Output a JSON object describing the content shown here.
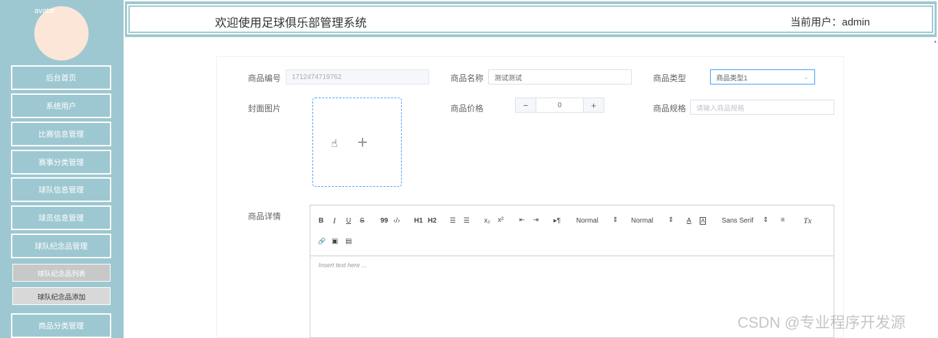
{
  "sidebar": {
    "avatar_alt": "avatar",
    "items": [
      {
        "label": "后台首页"
      },
      {
        "label": "系统用户"
      },
      {
        "label": "比赛信息管理"
      },
      {
        "label": "赛事分类管理"
      },
      {
        "label": "球队信息管理"
      },
      {
        "label": "球员信息管理"
      },
      {
        "label": "球队纪念品管理"
      },
      {
        "label": "商品分类管理"
      }
    ],
    "subitems": [
      {
        "label": "球队纪念品列表"
      },
      {
        "label": "球队纪念品添加"
      }
    ]
  },
  "header": {
    "title": "欢迎使用足球俱乐部管理系统",
    "user": "当前用户：admin"
  },
  "form": {
    "product_no_label": "商品编号",
    "product_no_value": "1712474719762",
    "product_name_label": "商品名称",
    "product_name_value": "测试测试",
    "product_type_label": "商品类型",
    "product_type_value": "商品类型1",
    "cover_label": "封面图片",
    "price_label": "商品价格",
    "price_value": "0",
    "price_minus": "−",
    "price_plus": "+",
    "spec_label": "商品规格",
    "spec_placeholder": "请输入商品规格",
    "detail_label": "商品详情"
  },
  "editor": {
    "toolbar": {
      "bold": "B",
      "italic": "I",
      "underline": "U",
      "strike": "S",
      "blockquote": "99",
      "code": "‹/›",
      "h1": "H1",
      "h2": "H2",
      "ordered_list": "☰",
      "bullet_list": "☰",
      "subscript": "x₂",
      "superscript": "x²",
      "outdent": "⇤",
      "indent": "⇥",
      "direction": "▸¶",
      "size_select": "Normal",
      "header_select": "Normal",
      "color": "A",
      "background": "A",
      "font_select": "Sans Serif",
      "align": "≡",
      "clean": "Tx",
      "link": "🔗",
      "image": "▣",
      "video": "▤"
    },
    "placeholder": "Insert text here ..."
  },
  "watermark": "CSDN @专业程序开发源"
}
